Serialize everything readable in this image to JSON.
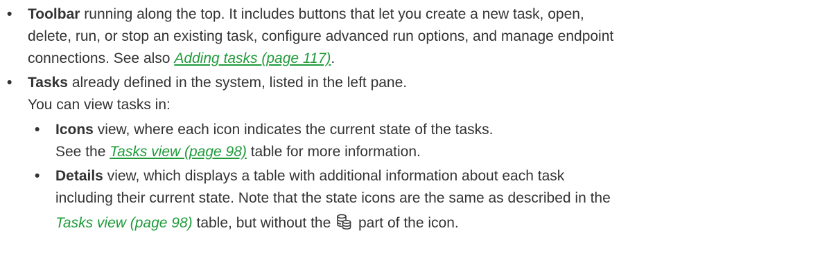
{
  "colors": {
    "text": "#333333",
    "link": "#1f9b3a",
    "icon": "#3a3a3a"
  },
  "bullets": {
    "toolbar": {
      "term": "Toolbar",
      "line1": " running along the top. It includes buttons that let you create a new task, open,",
      "line2": "delete, run, or stop an existing task, configure advanced run options, and manage endpoint",
      "line3": "connections. See also ",
      "link": "Adding tasks (page 117)",
      "end": "."
    },
    "tasks": {
      "term": "Tasks",
      "line1": " already defined in the system, listed in the left pane.",
      "line2": "You can view tasks in:",
      "sub": {
        "icons": {
          "term": "Icons",
          "line1": " view, where each icon indicates the current state of the tasks.",
          "line2a": "See the ",
          "link": "Tasks view (page 98)",
          "line2b": " table for more information."
        },
        "details": {
          "term": "Details",
          "line1": " view, which displays a table with additional information about each task",
          "line2": "including their current state. Note that the state icons are the same as described in the",
          "link": "Tasks view (page 98)",
          "line3a": " table, but without the ",
          "icon": "database-icon",
          "line3b": " part of the icon."
        }
      }
    }
  }
}
